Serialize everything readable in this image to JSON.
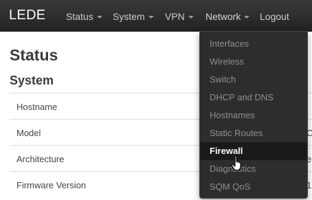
{
  "navbar": {
    "brand": "LEDE",
    "items": [
      {
        "label": "Status",
        "has_caret": true
      },
      {
        "label": "System",
        "has_caret": true
      },
      {
        "label": "VPN",
        "has_caret": true
      },
      {
        "label": "Network",
        "has_caret": true
      },
      {
        "label": "Logout",
        "has_caret": false
      }
    ]
  },
  "main": {
    "title": "Status",
    "section": "System",
    "rows": [
      {
        "label": "Hostname",
        "value_fragment": ""
      },
      {
        "label": "Model",
        "value_fragment": "C"
      },
      {
        "label": "Architecture",
        "value_fragment": "e"
      },
      {
        "label": "Firmware Version",
        "value_fragment": "1"
      }
    ]
  },
  "network_menu": {
    "items": [
      {
        "label": "Interfaces"
      },
      {
        "label": "Wireless"
      },
      {
        "label": "Switch"
      },
      {
        "label": "DHCP and DNS"
      },
      {
        "label": "Hostnames"
      },
      {
        "label": "Static Routes"
      },
      {
        "label": "Firewall",
        "active": true
      },
      {
        "label": "Diagnostics"
      },
      {
        "label": "SQM QoS"
      }
    ]
  },
  "colors": {
    "navbar_bg": "#2a2a2a",
    "menu_bg": "#2d2d2d",
    "menu_text": "#8e8e8e",
    "menu_active_text": "#ffffff"
  },
  "icons": {
    "cursor": "hand-pointer-icon"
  }
}
